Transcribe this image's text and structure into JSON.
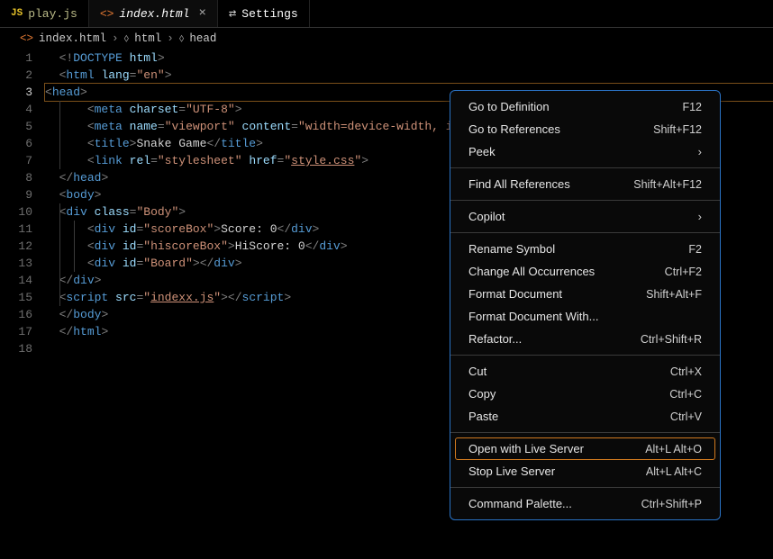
{
  "tabs": {
    "play": {
      "icon": "JS",
      "label": "play.js"
    },
    "index": {
      "label": "index.html",
      "close": "×"
    },
    "settings": {
      "label": "Settings"
    }
  },
  "breadcrumbs": {
    "item0": "index.html",
    "item1": "html",
    "item2": "head",
    "chev": "›"
  },
  "lines": {
    "n1": "1",
    "n2": "2",
    "n3": "3",
    "n4": "4",
    "n5": "5",
    "n6": "6",
    "n7": "7",
    "n8": "8",
    "n9": "9",
    "n10": "10",
    "n11": "11",
    "n12": "12",
    "n13": "13",
    "n14": "14",
    "n15": "15",
    "n16": "16",
    "n17": "17",
    "n18": "18"
  },
  "code": {
    "l1": {
      "a": "<!",
      "b": "DOCTYPE",
      "c": " ",
      "d": "html",
      "e": ">"
    },
    "l2": {
      "pre": "",
      "open": "<",
      "tag": "html",
      "sp": " ",
      "attr": "lang",
      "eq": "=",
      "val": "\"en\"",
      "close": ">"
    },
    "l3": {
      "pre": "",
      "open": "<",
      "tag": "head",
      "close": ">"
    },
    "l4": {
      "open": "<",
      "tag": "meta",
      "sp": " ",
      "attr": "charset",
      "eq": "=",
      "val": "\"UTF-8\"",
      "close": ">"
    },
    "l5": {
      "open": "<",
      "tag": "meta",
      "sp": " ",
      "attr1": "name",
      "eq": "=",
      "val1": "\"viewport\"",
      "sp2": " ",
      "attr2": "content",
      "val2": "\"width=device-width, i"
    },
    "l6": {
      "open": "<",
      "tag": "title",
      "close": ">",
      "text": "Snake Game",
      "copen": "</",
      "ctag": "title",
      "cclose": ">"
    },
    "l7": {
      "open": "<",
      "tag": "link",
      "sp": " ",
      "attr1": "rel",
      "eq": "=",
      "val1": "\"stylesheet\"",
      "sp2": " ",
      "attr2": "href",
      "val2": "\"",
      "link": "style.css",
      "val2b": "\"",
      "close": ">"
    },
    "l8": {
      "open": "</",
      "tag": "head",
      "close": ">"
    },
    "l9": {
      "open": "<",
      "tag": "body",
      "close": ">"
    },
    "l10": {
      "open": "<",
      "tag": "div",
      "sp": " ",
      "attr": "class",
      "eq": "=",
      "val": "\"Body\"",
      "close": ">"
    },
    "l11": {
      "open": "<",
      "tag": "div",
      "sp": " ",
      "attr": "id",
      "eq": "=",
      "val": "\"scoreBox\"",
      "close": ">",
      "text": "Score: 0",
      "copen": "</",
      "ctag": "div",
      "cclose": ">"
    },
    "l12": {
      "open": "<",
      "tag": "div",
      "sp": " ",
      "attr": "id",
      "eq": "=",
      "val": "\"hiscoreBox\"",
      "close": ">",
      "text": "HiScore: 0",
      "copen": "</",
      "ctag": "div",
      "cclose": ">"
    },
    "l13": {
      "open": "<",
      "tag": "div",
      "sp": " ",
      "attr": "id",
      "eq": "=",
      "val": "\"Board\"",
      "close": ">",
      "copen": "</",
      "ctag": "div",
      "cclose": ">"
    },
    "l14": {
      "open": "</",
      "tag": "div",
      "close": ">"
    },
    "l15": {
      "open": "<",
      "tag": "script",
      "sp": " ",
      "attr": "src",
      "eq": "=",
      "val": "\"",
      "link": "indexx.js",
      "valb": "\"",
      "close": ">",
      "copen": "</",
      "ctag": "script",
      "cclose": ">"
    },
    "l16": {
      "open": "</",
      "tag": "body",
      "close": ">"
    },
    "l17": {
      "open": "</",
      "tag": "html",
      "close": ">"
    }
  },
  "menu": {
    "goto_def": {
      "label": "Go to Definition",
      "shortcut": "F12"
    },
    "goto_ref": {
      "label": "Go to References",
      "shortcut": "Shift+F12"
    },
    "peek": {
      "label": "Peek",
      "arrow": "›"
    },
    "find_all": {
      "label": "Find All References",
      "shortcut": "Shift+Alt+F12"
    },
    "copilot": {
      "label": "Copilot",
      "arrow": "›"
    },
    "rename": {
      "label": "Rename Symbol",
      "shortcut": "F2"
    },
    "change_all": {
      "label": "Change All Occurrences",
      "shortcut": "Ctrl+F2"
    },
    "format_doc": {
      "label": "Format Document",
      "shortcut": "Shift+Alt+F"
    },
    "format_with": {
      "label": "Format Document With..."
    },
    "refactor": {
      "label": "Refactor...",
      "shortcut": "Ctrl+Shift+R"
    },
    "cut": {
      "label": "Cut",
      "shortcut": "Ctrl+X"
    },
    "copy": {
      "label": "Copy",
      "shortcut": "Ctrl+C"
    },
    "paste": {
      "label": "Paste",
      "shortcut": "Ctrl+V"
    },
    "live_open": {
      "label": "Open with Live Server",
      "shortcut": "Alt+L Alt+O"
    },
    "live_stop": {
      "label": "Stop Live Server",
      "shortcut": "Alt+L Alt+C"
    },
    "cmd_palette": {
      "label": "Command Palette...",
      "shortcut": "Ctrl+Shift+P"
    }
  }
}
